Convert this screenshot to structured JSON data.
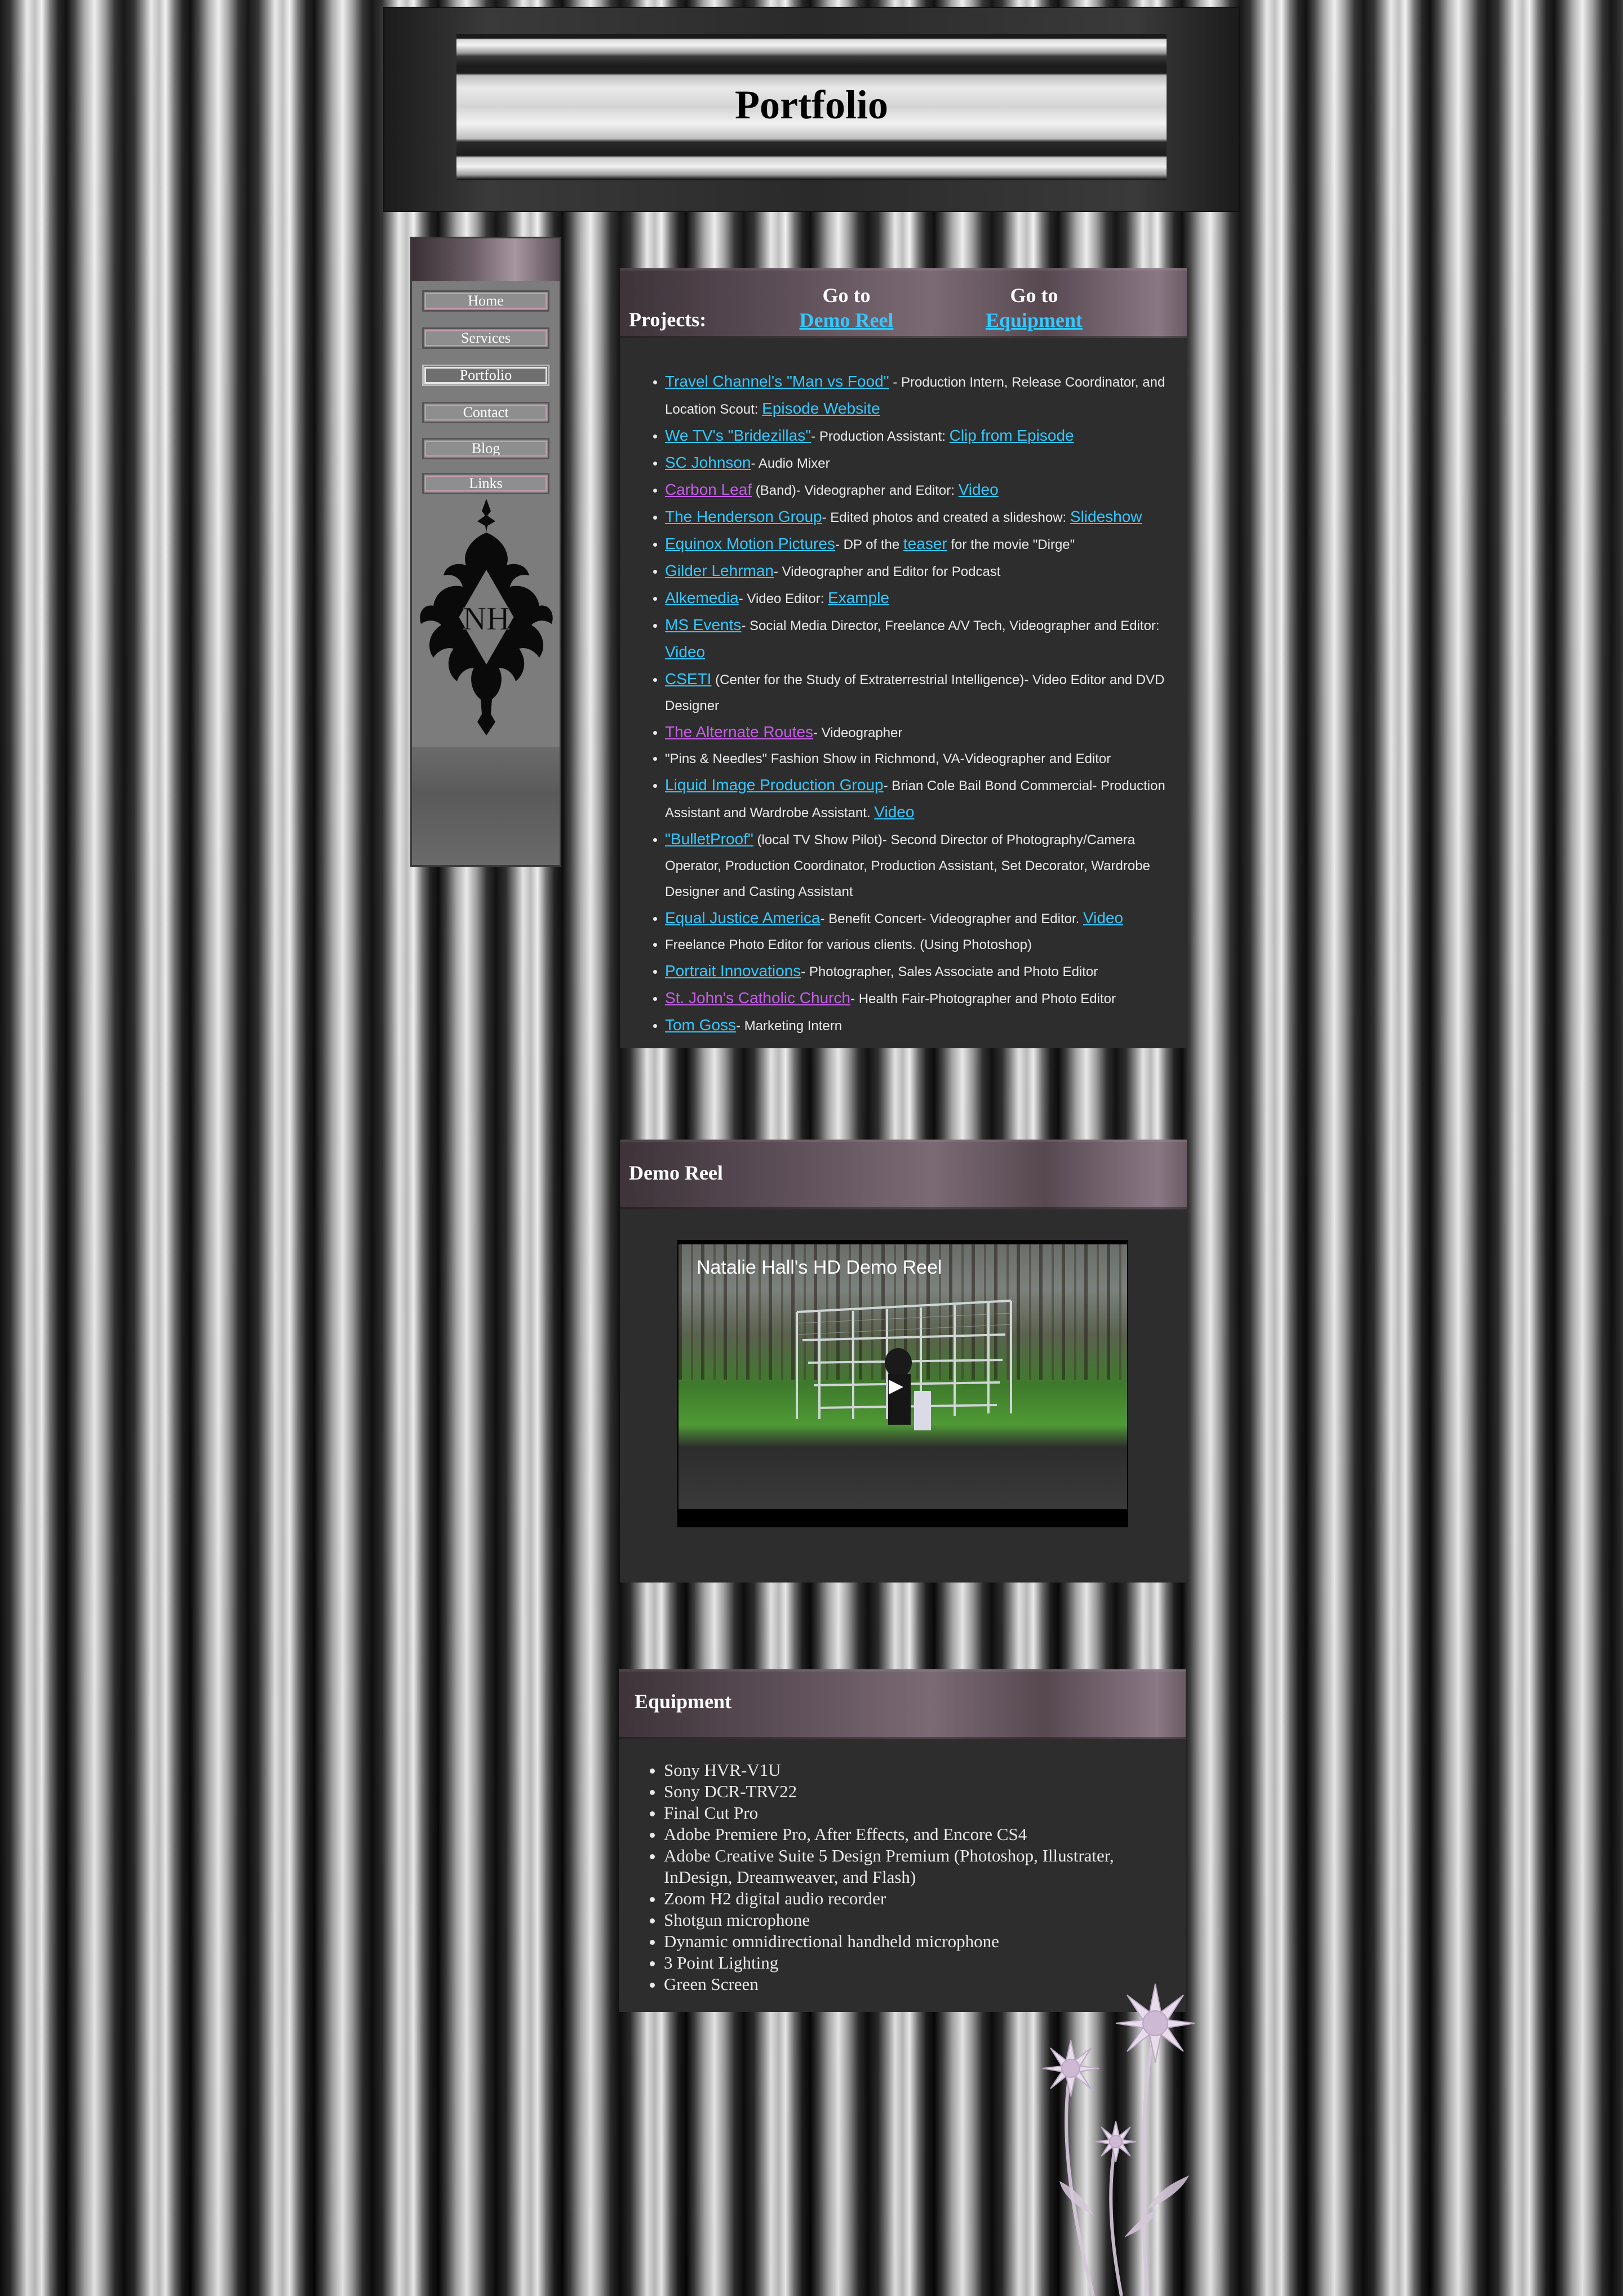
{
  "header": {
    "title": "Portfolio"
  },
  "nav": {
    "items": [
      {
        "label": "Home"
      },
      {
        "label": "Services"
      },
      {
        "label": "Portfolio",
        "active": true
      },
      {
        "label": "Contact"
      },
      {
        "label": "Blog"
      },
      {
        "label": "Links"
      }
    ],
    "emblem_text": "NH",
    "emblem_icon": "fleur-de-lis-emblem-icon"
  },
  "projects": {
    "title": "Projects:",
    "goto_demo": {
      "prefix": "Go to",
      "link": "Demo Reel"
    },
    "goto_equipment": {
      "prefix": "Go to",
      "link": "Equipment"
    },
    "items": [
      {
        "link": "Travel Channel's \"Man vs Food\"",
        "text": " - Production Intern, Release Coordinator, and Location Scout: ",
        "link2": "Episode Website"
      },
      {
        "link": "We TV's \"Bridezillas\"",
        "text": "- Production Assistant: ",
        "link2": "Clip from Episode"
      },
      {
        "link": "SC Johnson",
        "text": "- Audio Mixer"
      },
      {
        "link": "Carbon Leaf",
        "visited": true,
        "text": " (Band)- Videographer and Editor: ",
        "link2": "Video"
      },
      {
        "link": "The Henderson Group",
        "text": "- Edited photos and created a slideshow: ",
        "link2": "Slideshow"
      },
      {
        "link": "Equinox Motion Pictures",
        "text": "- DP of the ",
        "link2": "teaser",
        "text2": " for the movie \"Dirge\""
      },
      {
        "link": "Gilder Lehrman",
        "text": "- Videographer and Editor for Podcast"
      },
      {
        "link": "Alkemedia",
        "text": "- Video Editor: ",
        "link2": "Example"
      },
      {
        "link": "MS Events",
        "text": "- Social Media Director, Freelance A/V Tech, Videographer and Editor: ",
        "link2": "Video"
      },
      {
        "link": "CSETI",
        "text": " (Center for the Study of Extraterrestrial Intelligence)- Video Editor and DVD Designer"
      },
      {
        "link": "The Alternate Routes",
        "visited": true,
        "text": "- Videographer"
      },
      {
        "text": "\"Pins & Needles\" Fashion Show in Richmond, VA-Videographer and Editor"
      },
      {
        "link": "Liquid Image Production Group",
        "text": "- Brian Cole Bail Bond Commercial- Production Assistant and Wardrobe Assistant. ",
        "link2": "Video"
      },
      {
        "link": "\"BulletProof\"",
        "text": " (local TV Show Pilot)- Second Director of Photography/Camera Operator, Production Coordinator, Production Assistant, Set Decorator, Wardrobe Designer and Casting Assistant"
      },
      {
        "link": "Equal Justice America",
        "text": "- Benefit Concert- Videographer and Editor. ",
        "link2": "Video"
      },
      {
        "text": "Freelance Photo Editor for various clients. (Using Photoshop)"
      },
      {
        "link": "Portrait Innovations",
        "text": "- Photographer, Sales Associate and Photo Editor"
      },
      {
        "link": "St. John's Catholic Church",
        "visited": true,
        "text": "- Health Fair-Photographer and Photo Editor"
      },
      {
        "link": "Tom Goss",
        "text": "- Marketing Intern"
      }
    ]
  },
  "demo": {
    "title": "Demo Reel",
    "video_title": "Natalie Hall's HD Demo Reel",
    "play_icon": "play-icon"
  },
  "equipment": {
    "title": "Equipment",
    "items": [
      "Sony HVR-V1U",
      "Sony DCR-TRV22",
      "Final Cut Pro",
      "Adobe Premiere Pro, After Effects, and Encore CS4",
      "Adobe Creative Suite 5 Design Premium (Photoshop, Illustrater, InDesign, Dreamweaver, and Flash)",
      "Zoom H2 digital audio recorder",
      "Shotgun microphone",
      "Dynamic omnidirectional handheld microphone",
      "3 Point Lighting",
      "Green Screen"
    ]
  },
  "colors": {
    "link": "#33c8ff",
    "visited": "#c45ee6",
    "panel": "#2d2d2d"
  }
}
